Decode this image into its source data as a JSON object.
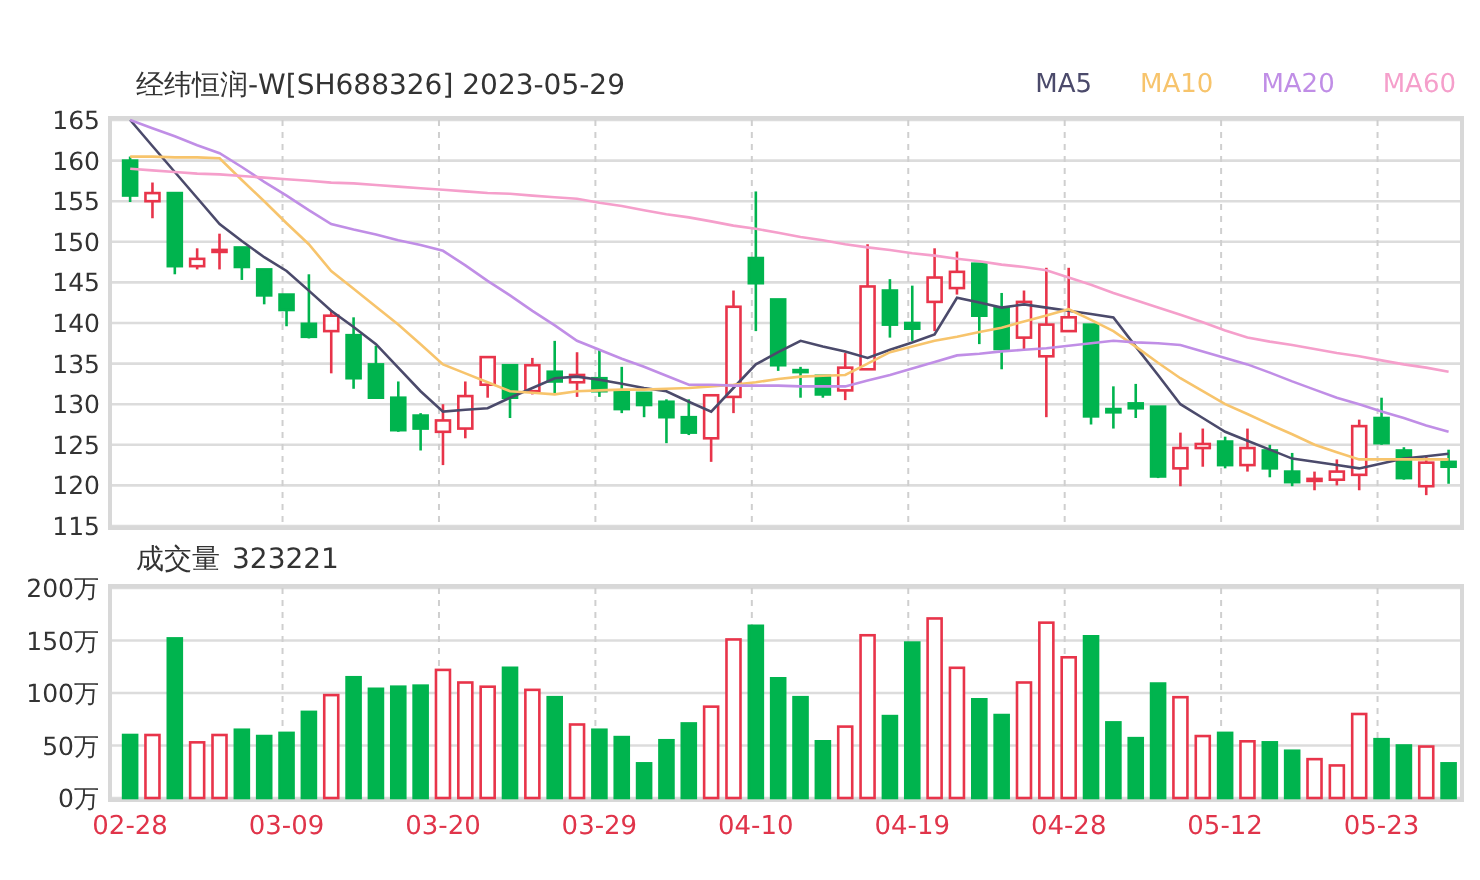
{
  "header": {
    "title": "经纬恒润-W[SH688326] 2023-05-29"
  },
  "price_chart": {
    "chart_data": {
      "type": "candlestick",
      "grid": true,
      "categories": [
        null,
        null,
        null,
        null,
        null,
        null,
        null,
        null,
        null,
        null,
        null,
        null,
        null,
        null,
        null,
        null,
        null,
        null,
        null,
        null,
        null,
        null,
        null,
        null,
        null,
        null,
        null,
        null,
        null,
        null,
        null,
        null,
        null,
        null,
        null,
        null,
        null,
        null,
        null,
        null,
        null,
        null,
        null,
        null,
        null,
        null,
        null,
        null,
        null,
        null,
        null,
        null,
        null,
        null,
        null,
        null,
        null,
        null,
        null,
        null
      ],
      "ylim": [
        115,
        165
      ],
      "yticks": [
        115,
        120,
        125,
        130,
        135,
        140,
        145,
        150,
        155,
        160,
        165
      ],
      "ohlc": [
        [
          160,
          160.5,
          154.9,
          155.7
        ],
        [
          155,
          157.3,
          152.9,
          156
        ],
        [
          156,
          156,
          146,
          147
        ],
        [
          147,
          149.2,
          146.6,
          147.9
        ],
        [
          148.8,
          151,
          146.6,
          149
        ],
        [
          149.3,
          149.3,
          145.3,
          146.9
        ],
        [
          146.6,
          146.6,
          142.3,
          143.4
        ],
        [
          143.5,
          143.5,
          139.6,
          141.6
        ],
        [
          139.9,
          146,
          138.1,
          138.3
        ],
        [
          139,
          141.6,
          133.8,
          140.9
        ],
        [
          138.5,
          140.7,
          131.9,
          133.2
        ],
        [
          134.9,
          137.2,
          130.8,
          130.8
        ],
        [
          130.8,
          132.8,
          126.6,
          126.8
        ],
        [
          128.6,
          128.9,
          124.3,
          127
        ],
        [
          126.6,
          130,
          122.5,
          128
        ],
        [
          127,
          132.8,
          125.8,
          131
        ],
        [
          132.4,
          135.8,
          130.8,
          135.8
        ],
        [
          134.8,
          134.8,
          128.3,
          130.8
        ],
        [
          131.6,
          135.7,
          131.2,
          134.8
        ],
        [
          134,
          137.8,
          131.2,
          132.8
        ],
        [
          132.7,
          136.4,
          130.9,
          133.6
        ],
        [
          133.2,
          136.7,
          130.9,
          131.6
        ],
        [
          131.7,
          134.6,
          128.9,
          129.4
        ],
        [
          131.4,
          131.4,
          128.4,
          129.9
        ],
        [
          130.3,
          130.6,
          125.2,
          128.4
        ],
        [
          128.4,
          130.6,
          126.2,
          126.5
        ],
        [
          125.8,
          131.1,
          122.9,
          131.1
        ],
        [
          130.9,
          144,
          128.9,
          142
        ],
        [
          148,
          156.2,
          139,
          144.9
        ],
        [
          142.9,
          142.9,
          134.1,
          134.8
        ],
        [
          134.2,
          134.6,
          130.8,
          134
        ],
        [
          133.5,
          133.5,
          130.8,
          131.2
        ],
        [
          131.7,
          136.3,
          130.5,
          134.5
        ],
        [
          134.3,
          149.7,
          134.3,
          144.5
        ],
        [
          144,
          145.4,
          138.2,
          139.8
        ],
        [
          140,
          144.6,
          137.8,
          139.3
        ],
        [
          142.6,
          149.2,
          139,
          145.6
        ],
        [
          144.3,
          148.8,
          143.5,
          146.3
        ],
        [
          147.3,
          147.3,
          137.4,
          140.9
        ],
        [
          141.9,
          143.7,
          134.3,
          136.8
        ],
        [
          138.2,
          144,
          136.8,
          142.6
        ],
        [
          135.9,
          146.8,
          128.4,
          139.8
        ],
        [
          139,
          146.8,
          139,
          140.7
        ],
        [
          139.8,
          139.8,
          127.5,
          128.5
        ],
        [
          129.4,
          132.2,
          127,
          129
        ],
        [
          130.1,
          132.5,
          128.3,
          129.5
        ],
        [
          129.7,
          129.7,
          120.9,
          121.1
        ],
        [
          122.1,
          126.5,
          119.9,
          124.6
        ],
        [
          124.6,
          127,
          122.3,
          125.1
        ],
        [
          125.4,
          126,
          122.1,
          122.5
        ],
        [
          122.5,
          127,
          121.7,
          124.6
        ],
        [
          124.3,
          125,
          121,
          122.1
        ],
        [
          121.7,
          124,
          119.9,
          120.4
        ],
        [
          120.6,
          121.7,
          119.4,
          120.8
        ],
        [
          120.7,
          123.2,
          120,
          121.7
        ],
        [
          121.3,
          128.1,
          119.4,
          127.3
        ],
        [
          128.3,
          130.8,
          125,
          125.2
        ],
        [
          124.3,
          124.7,
          120.7,
          120.9
        ],
        [
          119.9,
          123.6,
          118.8,
          122.8
        ],
        [
          122.9,
          124.4,
          120.2,
          122.3
        ]
      ]
    },
    "moving_averages": {
      "chart_data": {
        "type": "line",
        "categories": [
          null,
          null,
          null,
          null,
          null,
          null,
          null,
          null,
          null,
          null,
          null,
          null,
          null,
          null,
          null,
          null,
          null,
          null,
          null,
          null,
          null,
          null,
          null,
          null,
          null,
          null,
          null,
          null,
          null,
          null,
          null,
          null,
          null,
          null,
          null,
          null,
          null,
          null,
          null,
          null,
          null,
          null,
          null,
          null,
          null,
          null,
          null,
          null,
          null,
          null,
          null,
          null,
          null,
          null,
          null,
          null,
          null,
          null,
          null,
          null
        ],
        "ylim": [
          115,
          165
        ],
        "series": [
          {
            "name": "MA5",
            "color": "#4b4a6b",
            "values": [
              165,
              161.8,
              158.6,
              155.4,
              152.2,
              150.1,
              148.1,
              146.4,
              144,
              141.5,
              139.5,
              137.4,
              134.5,
              131.6,
              129.1,
              129.3,
              129.5,
              130.8,
              132,
              133.2,
              133.4,
              133,
              132.5,
              132,
              131.6,
              130.3,
              129.1,
              132,
              134.9,
              136.4,
              137.8,
              137.1,
              136.5,
              135.7,
              136.7,
              137.6,
              138.6,
              143.1,
              142.5,
              141.9,
              142.3,
              141.9,
              141.5,
              141.1,
              140.7,
              137.1,
              133.6,
              130,
              128.3,
              126.6,
              125.5,
              124.4,
              123.3,
              122.9,
              122.5,
              122.1,
              122.7,
              123.3,
              123.6,
              123.9
            ]
          },
          {
            "name": "MA10",
            "color": "#f7c46c",
            "values": [
              160.5,
              160.5,
              160.4,
              160.4,
              160.3,
              157.6,
              155,
              152.3,
              149.7,
              146.4,
              144.2,
              142,
              139.8,
              137.4,
              134.9,
              133.8,
              132.7,
              131.6,
              131.4,
              131.2,
              131.6,
              131.7,
              131.8,
              131.8,
              131.9,
              132,
              132.2,
              132.4,
              132.7,
              133.1,
              133.4,
              133.5,
              133.6,
              135,
              136.4,
              137.1,
              137.8,
              138.3,
              138.9,
              139.4,
              140.2,
              140.9,
              141.7,
              140.4,
              139,
              137.1,
              135.1,
              133.2,
              131.6,
              130,
              128.8,
              127.5,
              126.3,
              125,
              124.1,
              123.2,
              123.2,
              123.2,
              123.2,
              123.2
            ]
          },
          {
            "name": "MA20",
            "color": "#c08ee6",
            "values": [
              165,
              164,
              163,
              161.9,
              160.9,
              159.2,
              157.4,
              155.7,
              153.9,
              152.2,
              151.5,
              150.9,
              150.2,
              149.6,
              148.9,
              147.1,
              145.2,
              143.4,
              141.5,
              139.7,
              137.8,
              136.7,
              135.6,
              134.6,
              133.5,
              132.4,
              132.4,
              132.3,
              132.3,
              132.3,
              132.2,
              132.2,
              132.2,
              132.9,
              133.6,
              134.4,
              135.2,
              136,
              136.2,
              136.5,
              136.7,
              136.9,
              137.2,
              137.5,
              137.8,
              137.6,
              137.5,
              137.3,
              136.5,
              135.7,
              134.9,
              133.9,
              132.8,
              131.8,
              130.8,
              130,
              129.1,
              128.3,
              127.4,
              126.6
            ]
          },
          {
            "name": "MA60",
            "color": "#f59fcb",
            "values": [
              159,
              158.8,
              158.6,
              158.4,
              158.3,
              158.1,
              157.9,
              157.7,
              157.5,
              157.3,
              157.2,
              157,
              156.8,
              156.6,
              156.4,
              156.2,
              156,
              155.9,
              155.7,
              155.5,
              155.3,
              154.8,
              154.4,
              153.9,
              153.4,
              153,
              152.5,
              152,
              151.6,
              151.1,
              150.6,
              150.2,
              149.7,
              149.3,
              149,
              148.6,
              148.3,
              147.9,
              147.6,
              147.2,
              146.9,
              146.5,
              145.6,
              144.7,
              143.7,
              142.8,
              141.9,
              141,
              140.1,
              139.1,
              138.2,
              137.7,
              137.3,
              136.8,
              136.3,
              135.9,
              135.4,
              134.9,
              134.5,
              134
            ]
          }
        ]
      }
    }
  },
  "volume_chart": {
    "label": "成交量",
    "value": "323221",
    "chart_data": {
      "type": "bar",
      "grid": true,
      "categories": [
        "02-28",
        null,
        null,
        null,
        null,
        null,
        null,
        "03-09",
        null,
        null,
        null,
        null,
        null,
        null,
        "03-20",
        null,
        null,
        null,
        null,
        null,
        null,
        "03-29",
        null,
        null,
        null,
        null,
        null,
        null,
        "04-10",
        null,
        null,
        null,
        null,
        null,
        null,
        "04-19",
        null,
        null,
        null,
        null,
        null,
        null,
        "04-28",
        null,
        null,
        null,
        null,
        null,
        null,
        "05-12",
        null,
        null,
        null,
        null,
        null,
        null,
        "05-23",
        null,
        null,
        null
      ],
      "ylim": [
        0,
        200
      ],
      "yticks": [
        {
          "value": 0,
          "label": "0万"
        },
        {
          "value": 50,
          "label": "50万"
        },
        {
          "value": 100,
          "label": "100万"
        },
        {
          "value": 150,
          "label": "150万"
        },
        {
          "value": 200,
          "label": "200万"
        }
      ],
      "values": [
        60,
        60,
        152,
        53,
        60,
        65,
        59,
        62,
        82,
        98,
        115,
        104,
        106,
        107,
        122,
        110,
        106,
        124,
        103,
        96,
        70,
        65,
        58,
        33,
        55,
        71,
        87,
        151,
        164,
        114,
        96,
        54,
        68,
        155,
        78,
        148,
        171,
        124,
        94,
        79,
        110,
        167,
        134,
        154,
        72,
        57,
        109,
        96,
        59,
        62,
        54,
        53,
        45,
        37,
        31,
        80,
        56,
        50,
        49,
        33
      ]
    }
  }
}
